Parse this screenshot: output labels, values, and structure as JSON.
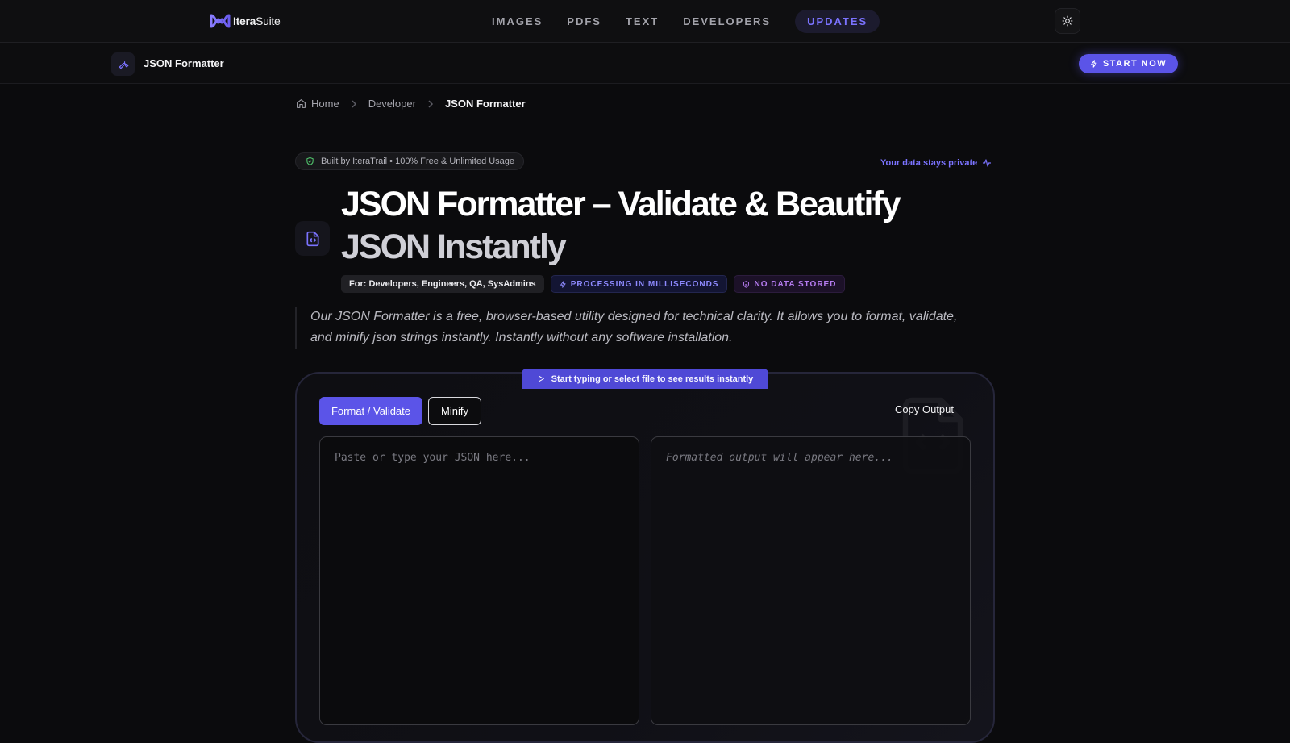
{
  "brand": {
    "name_bold": "Itera",
    "name_light": "Suite"
  },
  "nav": {
    "links": [
      "IMAGES",
      "PDFS",
      "TEXT",
      "DEVELOPERS"
    ],
    "updates": "UPDATES"
  },
  "subbar": {
    "tool_name": "JSON Formatter",
    "cta": "START NOW"
  },
  "breadcrumb": {
    "home": "Home",
    "section": "Developer",
    "current": "JSON Formatter"
  },
  "hero": {
    "built_badge": "Built by IteraTrail • 100% Free & Unlimited Usage",
    "privacy": "Your data stays private",
    "title_main": "JSON Formatter – Validate & Beautify",
    "title_sub": "JSON Instantly",
    "tags": {
      "audience": "For: Developers, Engineers, QA, SysAdmins",
      "speed": "PROCESSING IN MILLISECONDS",
      "nodata": "NO DATA STORED"
    },
    "description": "Our JSON Formatter is a free, browser-based utility designed for technical clarity. It allows you to format, validate, and minify json strings instantly. Instantly without any software installation."
  },
  "tool": {
    "hint": "Start typing or select file to see results instantly",
    "format_label": "Format / Validate",
    "minify_label": "Minify",
    "copy_label": "Copy Output",
    "input_placeholder": "Paste or type your JSON here...",
    "output_placeholder": "Formatted output will appear here..."
  },
  "colors": {
    "accent": "#5b54e8",
    "accent_text": "#7b73ff",
    "background": "#0b0b0d"
  },
  "icons": {
    "logo": "infinity-logo-icon",
    "theme": "sun-icon",
    "tool": "wrench-icon",
    "cta": "lightning-icon",
    "home": "home-icon",
    "shield": "shield-check-icon",
    "activity": "activity-icon",
    "file_code": "file-code-icon",
    "play": "play-icon"
  }
}
